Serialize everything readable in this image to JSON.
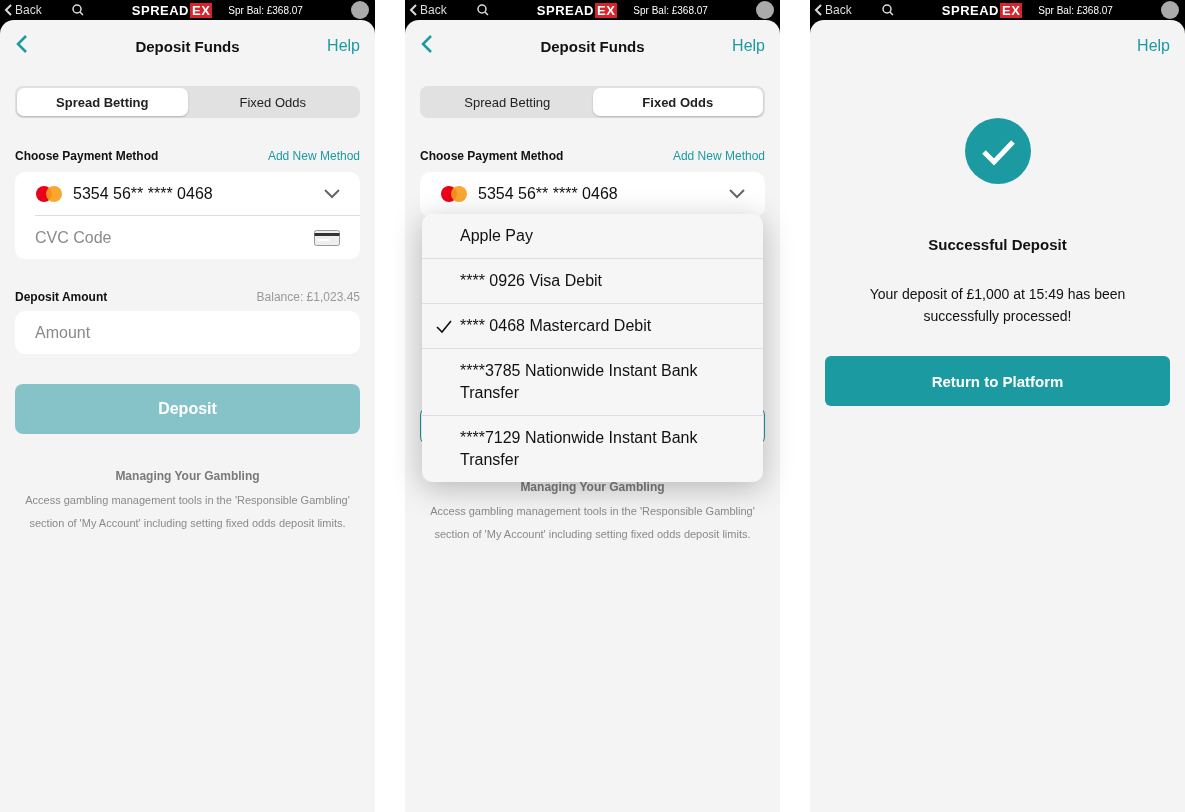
{
  "screens": [
    {
      "kind": "form",
      "status_bar": {
        "back": "Back",
        "logo_main": "SPREAD",
        "logo_accent": "EX",
        "balance": "Spr Bal: £368.07"
      },
      "header": {
        "title": "Deposit Funds",
        "help": "Help"
      },
      "tabs": [
        {
          "label": "Spread Betting",
          "selected": true
        },
        {
          "label": "Fixed Odds",
          "selected": false
        }
      ],
      "payment": {
        "label": "Choose Payment Method",
        "add_link": "Add New Method",
        "card_number": "5354 56** **** 0468",
        "cvc_placeholder": "CVC Code"
      },
      "amount": {
        "label": "Deposit Amount",
        "balance": "Balance: £1,023.45",
        "placeholder": "Amount"
      },
      "deposit_button": {
        "label": "Deposit",
        "disabled": true
      },
      "info": {
        "title": "Managing Your Gambling",
        "text": "Access gambling management tools in the 'Responsible Gambling' section of 'My Account' including setting fixed odds deposit limits."
      }
    },
    {
      "kind": "form",
      "status_bar": {
        "back": "Back",
        "logo_main": "SPREAD",
        "logo_accent": "EX",
        "balance": "Spr Bal: £368.07"
      },
      "header": {
        "title": "Deposit Funds",
        "help": "Help"
      },
      "tabs": [
        {
          "label": "Spread Betting",
          "selected": false
        },
        {
          "label": "Fixed Odds",
          "selected": true
        }
      ],
      "payment": {
        "label": "Choose Payment Method",
        "add_link": "Add New Method",
        "card_number": "5354 56** **** 0468"
      },
      "dropdown": {
        "options": [
          {
            "label": "Apple Pay",
            "selected": false
          },
          {
            "label": "**** 0926 Visa Debit",
            "selected": false
          },
          {
            "label": "**** 0468 Mastercard Debit",
            "selected": true
          },
          {
            "label": "****3785 Nationwide Instant Bank Transfer",
            "selected": false
          },
          {
            "label": "****7129 Nationwide Instant Bank Transfer",
            "selected": false
          }
        ]
      },
      "deposit_button": {
        "disabled": false
      },
      "info": {
        "title": "Managing Your Gambling",
        "text": "Access gambling management tools in the 'Responsible Gambling' section of 'My Account' including setting fixed odds deposit limits."
      }
    },
    {
      "kind": "success",
      "status_bar": {
        "back": "Back",
        "logo_main": "SPREAD",
        "logo_accent": "EX",
        "balance": "Spr Bal: £368.07"
      },
      "header": {
        "help": "Help"
      },
      "title": "Successful Deposit",
      "message": "Your deposit of £1,000 at 15:49 has been successfully processed!",
      "button": "Return to Platform"
    }
  ]
}
